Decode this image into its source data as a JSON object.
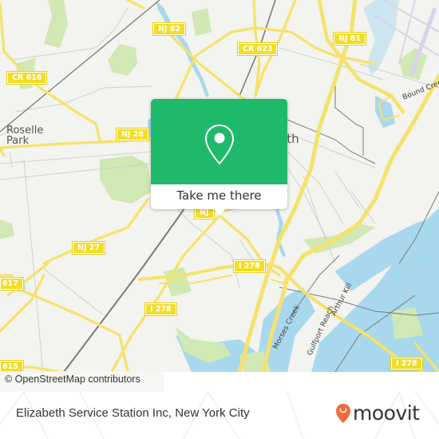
{
  "map": {
    "place_labels": {
      "roselle_park": [
        "Roselle",
        "Park"
      ],
      "elizabeth_partial": "eth"
    },
    "shields": {
      "nj82": "NJ 82",
      "cr623": "CR 623",
      "nj81": "NJ 81",
      "cr616": "CR 616",
      "nj28": "NJ 28",
      "nj27": "NJ 27",
      "nj_center": "NJ",
      "i278_a": "I 278",
      "i278_b": "I 278",
      "i278_c": "I 278",
      "cr617": "617",
      "cr615": "615"
    },
    "water_labels": {
      "moses_creek": "Morses Creek",
      "gulfport": "Gulfport Reach",
      "arthur_kill": "Arthur Kill",
      "bound_creek": "Bound Creek"
    },
    "colors": {
      "land": "#f3f3ef",
      "water": "#a8d8ee",
      "park": "#cfe8b4",
      "road_major": "#f5e26a",
      "road_minor": "#cfcfcf",
      "rail": "#7a7a7a"
    }
  },
  "attribution": "© OpenStreetMap contributors",
  "popup": {
    "icon": "map-pin-icon",
    "button_label": "Take me there",
    "color": "#1fb96b"
  },
  "footer": {
    "location_title": "Elizabeth Service Station Inc, New York City",
    "brand": "moovit",
    "brand_color": "#f26a3d"
  }
}
